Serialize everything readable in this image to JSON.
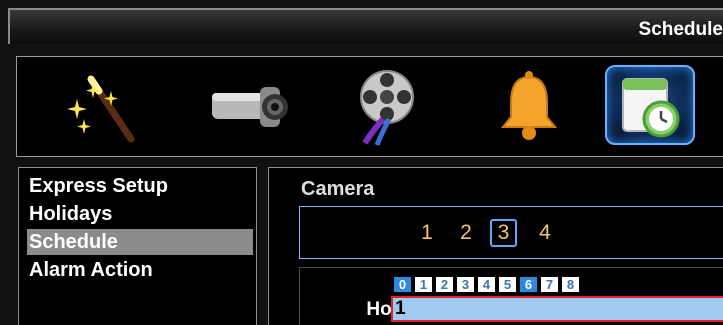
{
  "window": {
    "title": "Schedule"
  },
  "toolbar": {
    "icons": [
      {
        "name": "setup-wizard-icon"
      },
      {
        "name": "camera-icon"
      },
      {
        "name": "film-reel-icon"
      },
      {
        "name": "bell-icon"
      },
      {
        "name": "calendar-clock-icon",
        "selected": true
      }
    ]
  },
  "menu": {
    "items": [
      {
        "label": "Express Setup"
      },
      {
        "label": "Holidays"
      },
      {
        "label": "Schedule",
        "active": true
      },
      {
        "label": "Alarm Action"
      }
    ]
  },
  "main": {
    "camera_label": "Camera",
    "cameras": [
      "1",
      "2",
      "3",
      "4"
    ],
    "selected_camera": "3",
    "hours": [
      "0",
      "1",
      "2",
      "3",
      "4",
      "5",
      "6",
      "7",
      "8"
    ],
    "row": {
      "label": "Hol",
      "value": "1"
    }
  },
  "colors": {
    "accent_blue": "#2d89df",
    "menu_active": "#8b8b8b",
    "camera_number": "#f6c56a",
    "selected_row_border": "#e6202a",
    "field_bg": "#9fc9ef"
  }
}
